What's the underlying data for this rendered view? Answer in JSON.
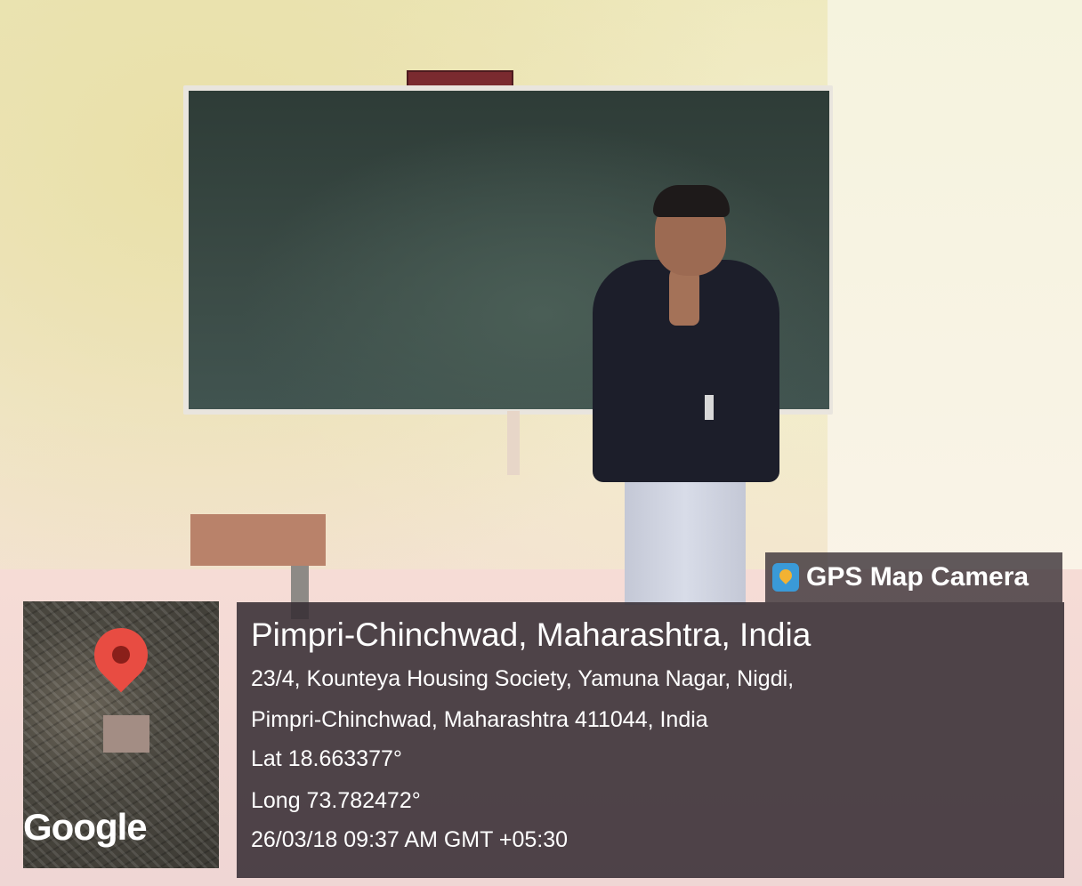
{
  "overlay": {
    "app_name": "GPS Map Camera",
    "place": "Pimpri-Chinchwad, Maharashtra, India",
    "address_line1": "23/4, Kounteya Housing Society, Yamuna Nagar, Nigdi,",
    "address_line2": "Pimpri-Chinchwad, Maharashtra 411044, India",
    "lat": "Lat 18.663377°",
    "long": "Long 73.782472°",
    "datetime": "26/03/18 09:37 AM GMT +05:30",
    "map_logo": "Google"
  },
  "icons": {
    "brand": "map-pin-camera-icon",
    "map_marker": "map-pin-icon"
  },
  "colors": {
    "overlay_bg": "#372e34",
    "pin": "#e84c42",
    "board": "#2e3c37"
  }
}
